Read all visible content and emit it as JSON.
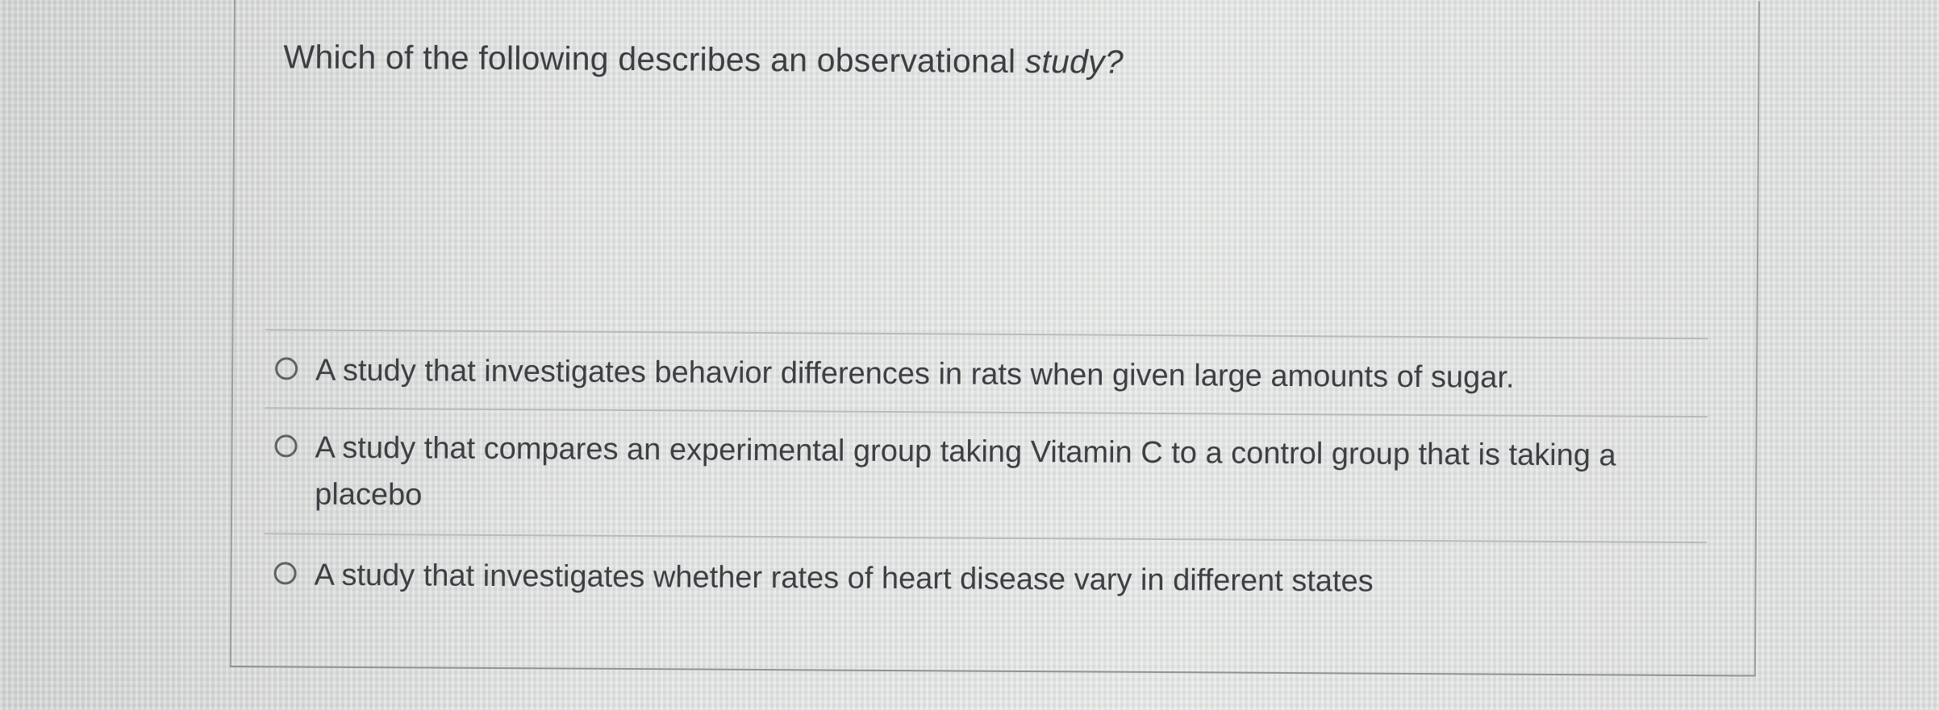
{
  "question": {
    "text_main": "Which of the following describes an observational ",
    "text_emphasis": "study?"
  },
  "options": [
    {
      "label": "A study that investigates behavior differences in rats when given large amounts of sugar.",
      "selected": false
    },
    {
      "label": "A study that compares an experimental group taking Vitamin C to a control group that is taking a placebo",
      "selected": false
    },
    {
      "label": "A study that investigates whether rates of heart disease vary in different states",
      "selected": false
    }
  ],
  "colors": {
    "background": "#dcdedd",
    "text": "#3b3e42",
    "border": "#9a9c9e"
  }
}
